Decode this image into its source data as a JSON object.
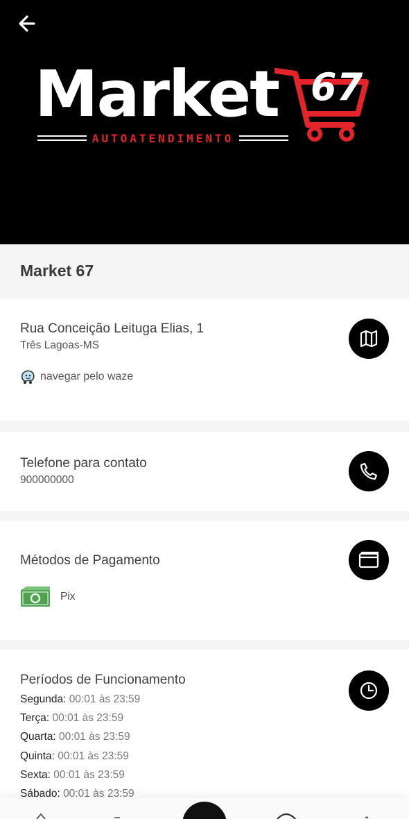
{
  "store": {
    "logo_word": "Market",
    "logo_number": "67",
    "logo_tagline": "AUTOATENDIMENTO",
    "name": "Market 67"
  },
  "address": {
    "street": " Rua Conceição Leituga Elias, 1",
    "city": "Três Lagoas-MS",
    "waze_label": "navegar pelo waze"
  },
  "phone": {
    "title": "Telefone para contato",
    "number": "900000000"
  },
  "payment": {
    "title": "Métodos de Pagamento",
    "methods": [
      "Pix"
    ]
  },
  "hours": {
    "title": "Períodos de Funcionamento",
    "schedule": [
      {
        "day": "Segunda:",
        "time": "00:01 às 23:59"
      },
      {
        "day": "Terça:",
        "time": "00:01 às 23:59"
      },
      {
        "day": "Quarta:",
        "time": "00:01 às 23:59"
      },
      {
        "day": "Quinta:",
        "time": "00:01 às 23:59"
      },
      {
        "day": "Sexta:",
        "time": "00:01 às 23:59"
      },
      {
        "day": "Sábado:",
        "time": "00:01 às 23:59"
      }
    ]
  },
  "colors": {
    "brand_red": "#e3242b",
    "header_bg": "#000000",
    "pix_green": "#5cb85c"
  },
  "icons": {
    "back": "arrow-left-icon",
    "map": "map-icon",
    "phone": "phone-icon",
    "payment": "wallet-card-icon",
    "hours": "clock-icon",
    "waze": "waze-icon",
    "money": "money-bill-icon"
  }
}
